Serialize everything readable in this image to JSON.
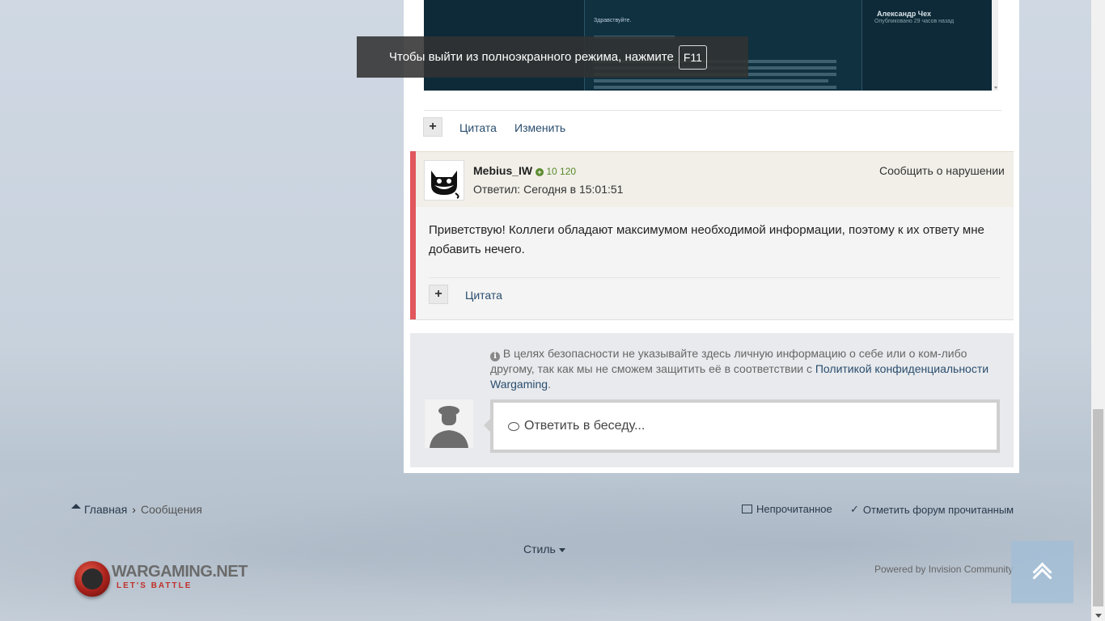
{
  "fullscreen_notice": {
    "text": "Чтобы выйти из полноэкранного режима, нажмите",
    "key": "F11"
  },
  "embedded_image": {
    "author": "Александр Чех",
    "published": "Опубликовано 29 часов назад",
    "greeting": "Здравствуйте."
  },
  "post1_actions": {
    "quote": "Цитата",
    "edit": "Изменить"
  },
  "post2": {
    "username": "Mebius_IW",
    "reputation": "10 120",
    "replied": "Ответил: Сегодня в 15:01:51",
    "report": "Сообщить о нарушении",
    "text": "Приветствую! Коллеги обладают максимумом необходимой информации, поэтому к их ответу мне добавить нечего.",
    "quote": "Цитата"
  },
  "reply": {
    "notice_text": "В целях безопасности не указывайте здесь личную информацию о себе или о ком-либо другому, так как мы не сможем защитить её в соответствии с",
    "notice_link": "Политикой конфиденциальности Wargaming",
    "notice_end": ".",
    "placeholder": "Ответить в беседу..."
  },
  "footer": {
    "breadcrumb_home": "Главная",
    "breadcrumb_current": "Сообщения",
    "unread": "Непрочитанное",
    "mark_read": "Отметить форум прочитанным",
    "style": "Стиль",
    "powered_by": "Powered by Invision Community",
    "logo_name": "WARGAMING.NET",
    "logo_tagline": "LET'S BATTLE"
  },
  "colors": {
    "accent_red": "#e0575d",
    "link": "#2a4d6e",
    "rep_green": "#5a8a2c"
  }
}
